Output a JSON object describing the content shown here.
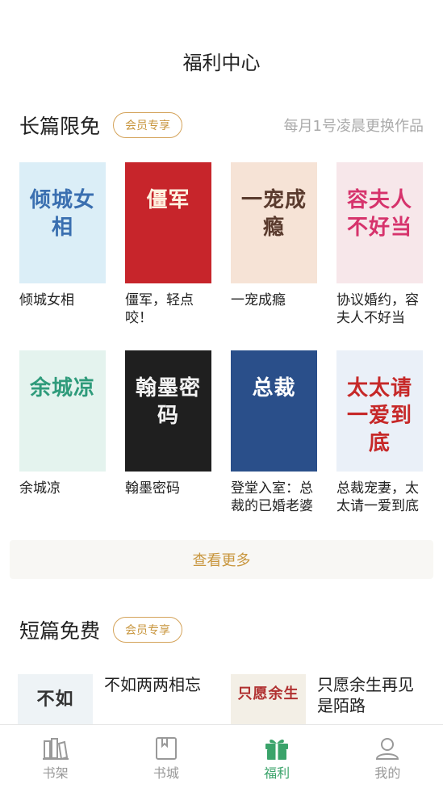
{
  "header": {
    "title": "福利中心"
  },
  "long_section": {
    "title": "长篇限免",
    "badge": "会员专享",
    "note": "每月1号凌晨更换作品",
    "books": [
      {
        "name": "倾城女相",
        "cover_text": "倾城女相",
        "cover_color": "#dbeef7",
        "text_color": "#3a6fb0"
      },
      {
        "name": "僵军，轻点咬！",
        "cover_text": "僵军",
        "cover_color": "#c7252b",
        "text_color": "#fff2e0"
      },
      {
        "name": "一宠成瘾",
        "cover_text": "一宠成瘾",
        "cover_color": "#f6e3d6",
        "text_color": "#5a3b2e"
      },
      {
        "name": "协议婚约，容夫人不好当",
        "cover_text": "容夫人不好当",
        "cover_color": "#f7e7ea",
        "text_color": "#d6336c"
      },
      {
        "name": "余城凉",
        "cover_text": "余城凉",
        "cover_color": "#e4f3ee",
        "text_color": "#2f9b7b"
      },
      {
        "name": "翰墨密码",
        "cover_text": "翰墨密码",
        "cover_color": "#1f1f1f",
        "text_color": "#f2f2f2"
      },
      {
        "name": "登堂入室：总裁的已婚老婆",
        "cover_text": "总裁",
        "cover_color": "#2a4f8a",
        "text_color": "#ffffff"
      },
      {
        "name": "总裁宠妻，太太请一爱到底",
        "cover_text": "太太请一爱到底",
        "cover_color": "#eaf0f8",
        "text_color": "#c62828"
      }
    ],
    "more_label": "查看更多"
  },
  "short_section": {
    "title": "短篇免费",
    "badge": "会员专享",
    "items": [
      {
        "name": "不如两两相忘",
        "cover_text": "不如",
        "cover_color": "#eef3f6",
        "text_color": "#333333"
      },
      {
        "name": "只愿余生再见是陌路",
        "cover_text": "只愿余生",
        "cover_color": "#f3efe6",
        "text_color": "#b03030"
      }
    ]
  },
  "tabs": [
    {
      "label": "书架",
      "icon": "bookshelf-icon",
      "active": false
    },
    {
      "label": "书城",
      "icon": "bookstore-icon",
      "active": false
    },
    {
      "label": "福利",
      "icon": "gift-icon",
      "active": true
    },
    {
      "label": "我的",
      "icon": "profile-icon",
      "active": false
    }
  ],
  "colors": {
    "accent": "#3aa36a",
    "gold": "#c8963e",
    "inactive": "#999999"
  }
}
